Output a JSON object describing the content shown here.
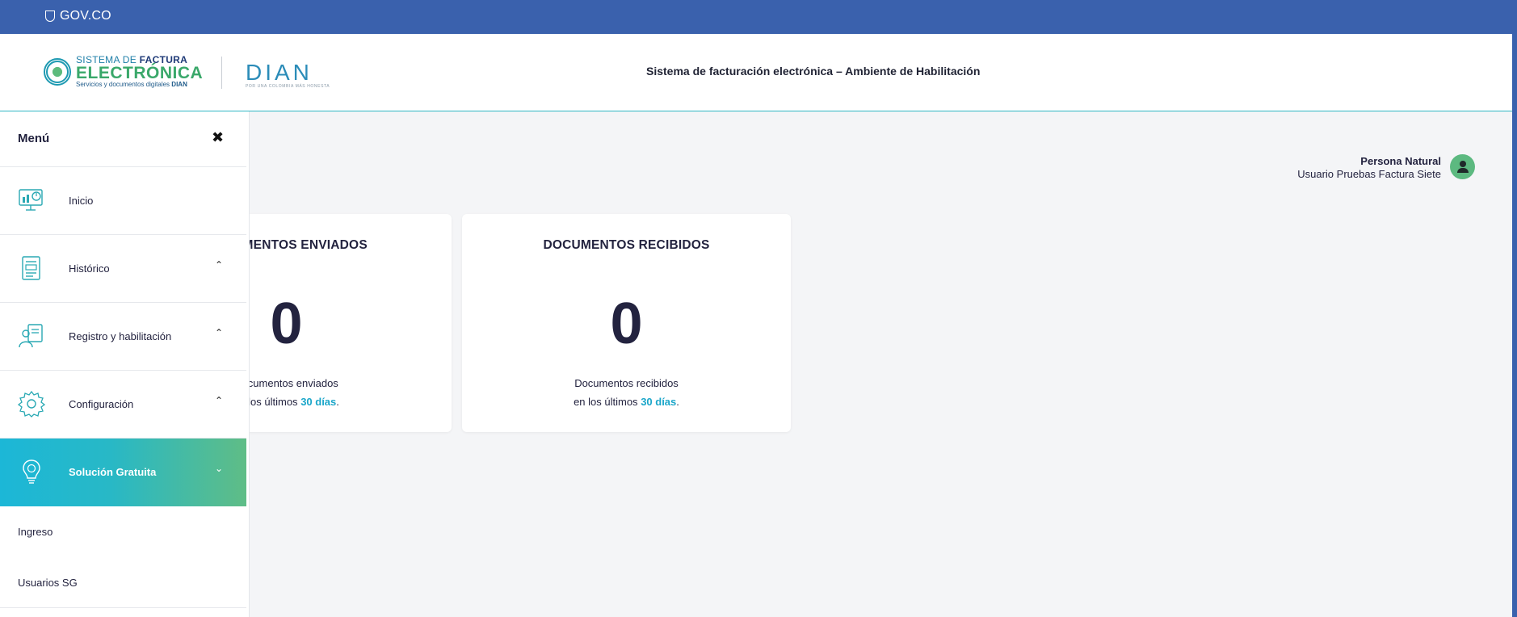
{
  "gov_bar": {
    "label": "GOV.CO"
  },
  "header": {
    "logo_line1_a": "SISTEMA DE",
    "logo_line1_b": "FACTURA",
    "logo_line2": "ELECTRÓNICA",
    "logo_line3_a": "Servicios y documentos digitales",
    "logo_line3_b": "DIAN",
    "dian_logo": "DIAN",
    "dian_tagline": "POR UNA COLOMBIA MÁS HONESTA",
    "title": "Sistema de facturación electrónica – Ambiente de Habilitación"
  },
  "user": {
    "role": "Persona Natural",
    "name": "Usuario Pruebas Factura Siete"
  },
  "cards": [
    {
      "title": "DOCUMENTOS ENVIADOS",
      "value": "0",
      "desc_line1": "Documentos enviados",
      "desc_prefix": "en los últimos",
      "desc_highlight": "30 días",
      "desc_suffix": "."
    },
    {
      "title": "DOCUMENTOS RECIBIDOS",
      "value": "0",
      "desc_line1": "Documentos recibidos",
      "desc_prefix": "en los últimos",
      "desc_highlight": "30 días",
      "desc_suffix": "."
    }
  ],
  "sidebar": {
    "title": "Menú",
    "close": "✖",
    "items": [
      {
        "label": "Inicio",
        "icon": "monitor-chart-icon",
        "chevron": ""
      },
      {
        "label": "Histórico",
        "icon": "document-list-icon",
        "chevron": "⌃"
      },
      {
        "label": "Registro y habilitación",
        "icon": "clipboard-person-icon",
        "chevron": "⌃"
      },
      {
        "label": "Configuración",
        "icon": "gear-icon",
        "chevron": "⌃"
      },
      {
        "label": "Solución Gratuita",
        "icon": "lightbulb-coin-icon",
        "chevron": "⌄"
      }
    ],
    "subitems": [
      {
        "label": "Ingreso"
      },
      {
        "label": "Usuarios SG"
      }
    ]
  },
  "colors": {
    "gov_bar": "#3a61ad",
    "accent_teal": "#1aa6c9",
    "accent_green": "#5fbd86",
    "text_dark": "#23233f"
  }
}
